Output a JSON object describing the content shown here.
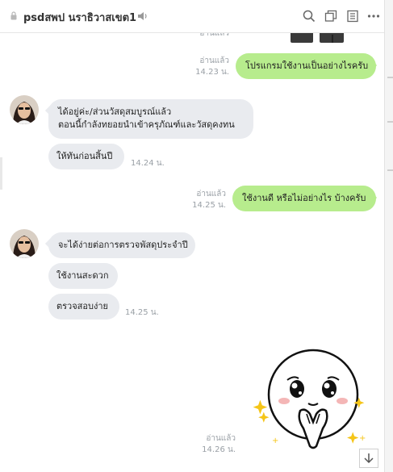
{
  "header": {
    "chat_title": "psdสพป นราธิวาสเขต1",
    "icons": [
      "lock-icon",
      "speaker-icon",
      "search-icon",
      "window-icon",
      "notes-icon",
      "more-icon"
    ]
  },
  "messages": {
    "top_read_partial": "อ่านแล้ว",
    "m1": {
      "text": "โปรแกรมใช้งานเป็นอย่างไรครับ",
      "read": "อ่านแล้ว",
      "time": "14.23 น."
    },
    "m2": {
      "line1": "ได้อยู่ค่ะ/ส่วนวัสดุสมบูรณ์แล้ว",
      "line2": "ตอนนี้กำลังทยอยนำเข้าครุภัณฑ์และวัสดุคงทน"
    },
    "m3": {
      "text": "ให้ทันก่อนสิ้นปี",
      "time": "14.24 น."
    },
    "m4": {
      "text": "ใช้งานดี หรือไม่อย่างไร บ้างครับ",
      "read": "อ่านแล้ว",
      "time": "14.25 น."
    },
    "m5": {
      "text": "จะได้ง่ายต่อการตรวจพัสดุประจำปี"
    },
    "m6": {
      "text": "ใช้งานสะดวก"
    },
    "m7": {
      "text": "ตรวจสอบง่าย",
      "time": "14.25 น."
    },
    "sticker": {
      "read": "อ่านแล้ว",
      "time": "14.26 น."
    }
  },
  "colors": {
    "outgoing": "#b7ec8d",
    "incoming": "#e9ebef",
    "meta": "#9aa0a6"
  }
}
